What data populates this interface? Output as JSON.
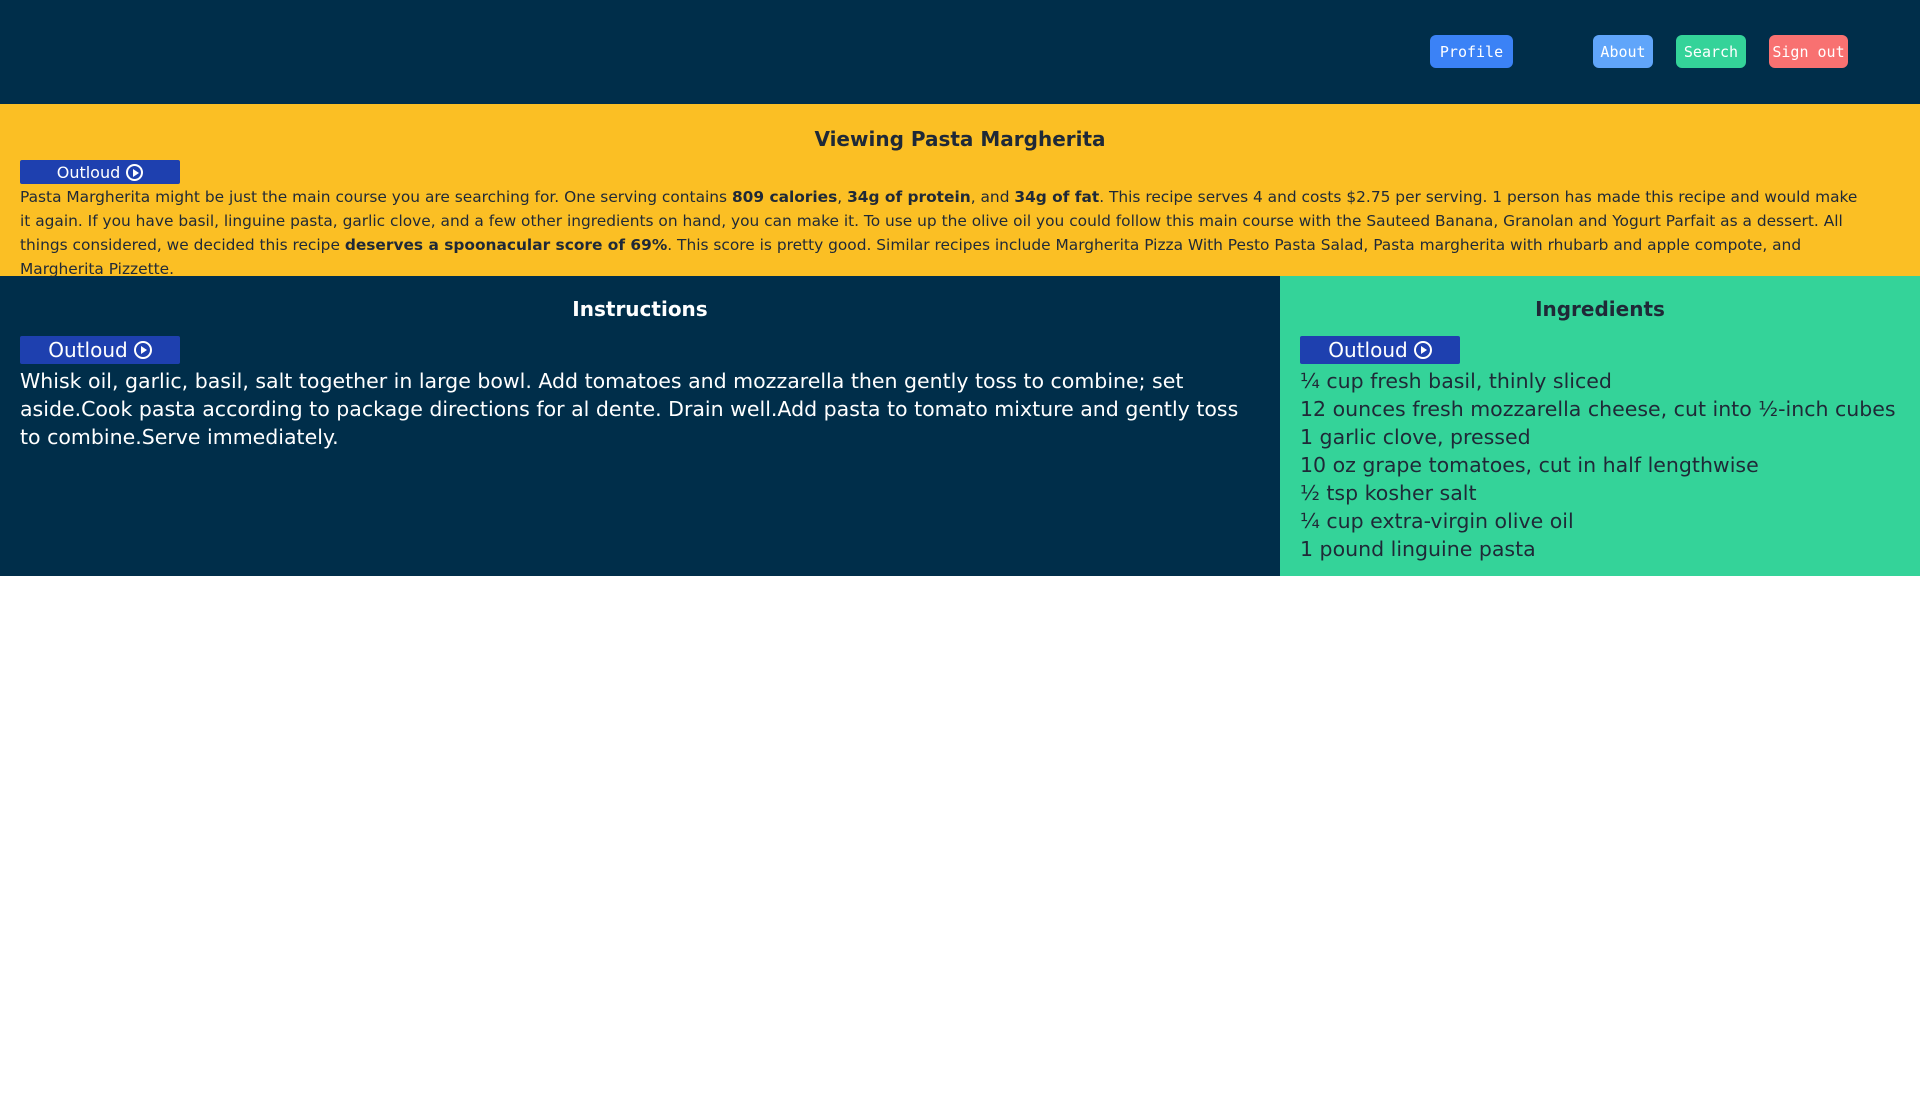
{
  "nav": {
    "profile": "Profile",
    "about": "About",
    "search": "Search",
    "sign_out": "Sign out"
  },
  "summary": {
    "title": "Viewing Pasta Margherita",
    "outloud_label": "Outloud",
    "segments": [
      {
        "text": "Pasta Margherita might be just the main course you are searching for. One serving contains ",
        "bold": false
      },
      {
        "text": "809 calories",
        "bold": true
      },
      {
        "text": ", ",
        "bold": false
      },
      {
        "text": "34g of protein",
        "bold": true
      },
      {
        "text": ", and ",
        "bold": false
      },
      {
        "text": "34g of fat",
        "bold": true
      },
      {
        "text": ". This recipe serves 4 and costs $2.75 per serving. 1 person has made this recipe and would make it again. If you have basil, linguine pasta, garlic clove, and a few other ingredients on hand, you can make it. To use up the olive oil you could follow this main course with the Sauteed Banana, Granolan and Yogurt Parfait as a dessert. All things considered, we decided this recipe ",
        "bold": false
      },
      {
        "text": "deserves a spoonacular score of 69%",
        "bold": true
      },
      {
        "text": ". This score is pretty good. Similar recipes include Margherita Pizza With Pesto Pasta Salad, Pasta margherita with rhubarb and apple compote, and Margherita Pizzette.",
        "bold": false
      }
    ]
  },
  "instructions": {
    "title": "Instructions",
    "outloud_label": "Outloud",
    "text": "Whisk oil, garlic, basil, salt together in large bowl. Add tomatoes and mozzarella then gently toss to combine; set aside.Cook pasta according to package directions for al dente. Drain well.Add pasta to tomato mixture and gently toss to combine.Serve immediately."
  },
  "ingredients": {
    "title": "Ingredients",
    "outloud_label": "Outloud",
    "items": [
      "¼ cup fresh basil, thinly sliced",
      "12 ounces fresh mozzarella cheese, cut into ½-inch cubes",
      "1 garlic clove, pressed",
      "10 oz grape tomatoes, cut in half lengthwise",
      "½ tsp kosher salt",
      "¼ cup extra-virgin olive oil",
      "1 pound linguine pasta"
    ]
  },
  "icons": {
    "outloud": "play-circle-icon"
  },
  "colors": {
    "header_bg": "#002e4a",
    "summary_bg": "#fbbf24",
    "ingredients_bg": "#34d399",
    "outloud_bg": "#1e40af",
    "profile_btn": "#3b82f6",
    "about_btn": "#60a5fa",
    "search_btn": "#34d399",
    "signout_btn": "#f87171"
  }
}
